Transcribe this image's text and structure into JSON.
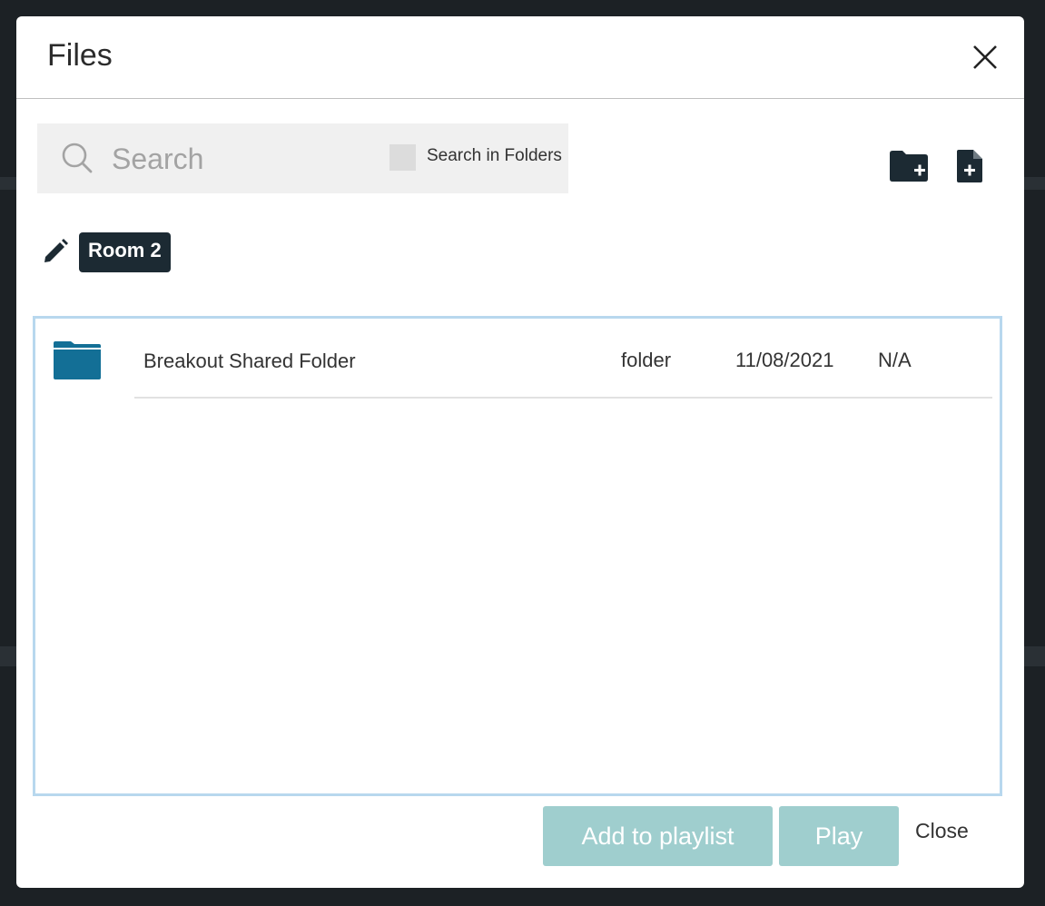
{
  "dialog": {
    "title": "Files"
  },
  "search": {
    "placeholder": "Search",
    "value": "",
    "search_in_folders_label": "Search in Folders",
    "search_in_folders_checked": false
  },
  "toolbar": {
    "new_folder_icon": "folder-plus-icon",
    "new_file_icon": "file-plus-icon"
  },
  "breadcrumb": {
    "edit_icon": "pencil-icon",
    "current": "Room 2"
  },
  "files": [
    {
      "icon": "folder-icon",
      "name": "Breakout Shared Folder",
      "type": "folder",
      "date": "11/08/2021",
      "size": "N/A"
    }
  ],
  "footer": {
    "add_to_playlist_label": "Add to playlist",
    "play_label": "Play",
    "close_label": "Close"
  },
  "colors": {
    "backdrop": "#1c2125",
    "accent_button": "#9fcece",
    "folder_icon": "#136f96",
    "toolbar_icon": "#1c2a33",
    "breadcrumb_bg": "#1c2a33",
    "list_border": "#b8d8ee"
  }
}
